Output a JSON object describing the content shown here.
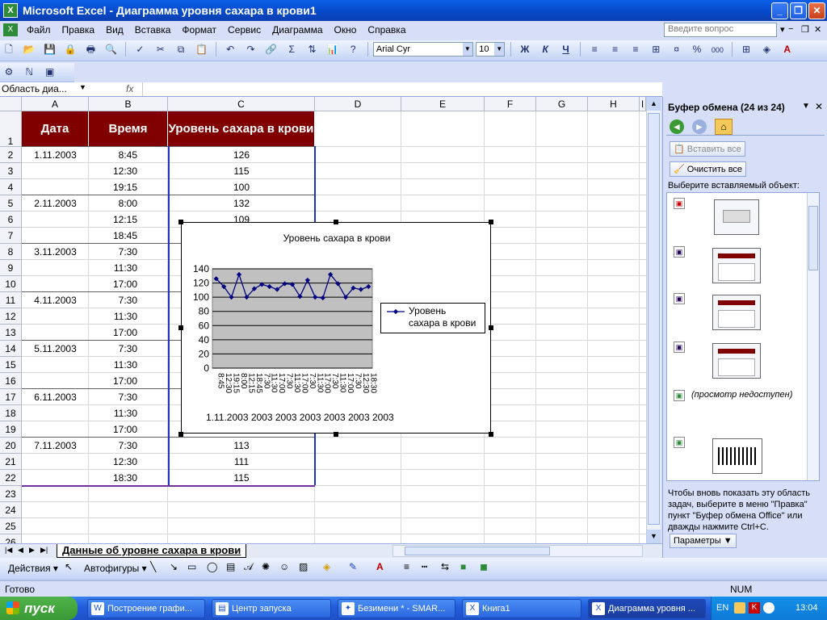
{
  "window": {
    "title": "Microsoft Excel - Диаграмма уровня сахара в крови1",
    "app_icon": "X"
  },
  "menu": [
    "Файл",
    "Правка",
    "Вид",
    "Вставка",
    "Формат",
    "Сервис",
    "Диаграмма",
    "Окно",
    "Справка"
  ],
  "ask_box": {
    "placeholder": "Введите вопрос"
  },
  "toolbar": {
    "font_name": "Arial Cyr",
    "font_size": "10",
    "bold": "Ж",
    "italic": "К",
    "underline": "Ч",
    "sum": "Σ",
    "percent": "%",
    "thousands": "000",
    "font_color_letter": "A"
  },
  "formula_bar": {
    "name_box": "Область диа...",
    "fx": "fx"
  },
  "sheet": {
    "columns": [
      "A",
      "B",
      "C",
      "D",
      "E",
      "F",
      "G",
      "H",
      "I"
    ],
    "rows": [
      "1",
      "2",
      "3",
      "4",
      "5",
      "6",
      "7",
      "8",
      "9",
      "10",
      "11",
      "12",
      "13",
      "14",
      "15",
      "16",
      "17",
      "18",
      "19",
      "20",
      "21",
      "22",
      "23",
      "24",
      "25",
      "26"
    ],
    "headers": [
      "Дата",
      "Время",
      "Уровень сахара в крови"
    ],
    "dates": [
      "1.11.2003",
      "2.11.2003",
      "3.11.2003",
      "4.11.2003",
      "5.11.2003",
      "6.11.2003",
      "7.11.2003"
    ],
    "times": [
      "8:45",
      "12:30",
      "19:15",
      "8:00",
      "12:15",
      "18:45",
      "7:30",
      "11:30",
      "17:00",
      "7:30",
      "11:30",
      "17:00",
      "7:30",
      "11:30",
      "17:00",
      "7:30",
      "11:30",
      "17:00",
      "7:30",
      "12:30",
      "18:30"
    ],
    "levels_visible": [
      "126",
      "115",
      "100",
      "132",
      "109",
      "",
      "",
      "",
      "",
      "",
      "",
      "",
      "",
      "",
      "",
      "",
      "",
      "",
      "113",
      "111",
      "115"
    ]
  },
  "chart": {
    "title": "Уровень сахара в крови",
    "legend": [
      "Уровень",
      "сахара в крови"
    ],
    "y_ticks": [
      "140",
      "120",
      "100",
      "80",
      "60",
      "40",
      "20",
      "0"
    ],
    "x_label_bottom": "1.11.2003 2003 2003 2003 2003 2003 2003"
  },
  "chart_data": {
    "type": "line",
    "title": "Уровень сахара в крови",
    "xlabel": "",
    "ylabel": "",
    "ylim": [
      0,
      140
    ],
    "grid": true,
    "legend_position": "right",
    "categories": [
      "8:45",
      "12:30",
      "19:15",
      "8:00",
      "12:15",
      "18:45",
      "7:30",
      "11:30",
      "17:00",
      "7:30",
      "11:30",
      "17:00",
      "7:30",
      "11:30",
      "17:00",
      "7:30",
      "11:30",
      "17:00",
      "7:30",
      "12:30",
      "18:30"
    ],
    "series": [
      {
        "name": "Уровень сахара в крови",
        "values": [
          126,
          115,
          100,
          132,
          100,
          112,
          118,
          115,
          111,
          119,
          118,
          101,
          124,
          100,
          99,
          132,
          119,
          100,
          113,
          111,
          115
        ]
      }
    ],
    "colors": {
      "line": "#000080",
      "plot_area": "#C0C0C0"
    }
  },
  "sheet_tab": "Данные об уровне сахара в крови",
  "task_pane": {
    "title": "Буфер обмена (24 из 24)",
    "paste_all": "Вставить все",
    "clear_all": "Очистить все",
    "select_prompt": "Выберите вставляемый объект:",
    "unavailable": "(просмотр недоступен)",
    "help_text": "Чтобы вновь показать эту область задач, выберите в меню \"Правка\" пункт \"Буфер обмена Office\" или дважды нажмите Ctrl+C.",
    "params": "Параметры"
  },
  "draw_toolbar": {
    "actions": "Действия",
    "autoshapes": "Автофигуры"
  },
  "status": {
    "ready": "Готово",
    "num": "NUM"
  },
  "taskbar": {
    "start": "пуск",
    "items": [
      "Построение графи...",
      "Центр запуска",
      "Безимени * - SMAR...",
      "Книга1",
      "Диаграмма уровня ..."
    ],
    "lang": "EN",
    "clock": "13:04"
  }
}
